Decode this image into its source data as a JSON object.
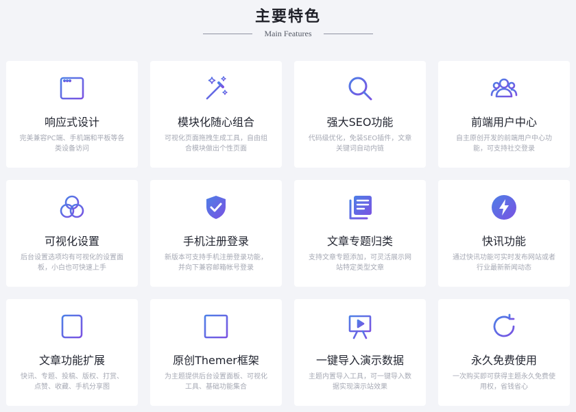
{
  "header": {
    "title": "主要特色",
    "subtitle": "Main Features"
  },
  "colors": {
    "icon_gradient_start": "#4d7fe6",
    "icon_gradient_end": "#7a52e2"
  },
  "features": [
    {
      "label": "响应式设计",
      "desc": "完美兼容PC端、手机端和平板等各类设备访问",
      "icon": "browser-window-icon"
    },
    {
      "label": "模块化随心组合",
      "desc": "可视化页面拖拽生成工具，自由组合模块做出个性页面",
      "icon": "magic-wand-icon"
    },
    {
      "label": "强大SEO功能",
      "desc": "代码级优化，免装SEO插件，文章关键词自动内链",
      "icon": "search-icon"
    },
    {
      "label": "前端用户中心",
      "desc": "自主原创开发的前端用户中心功能，可支持社交登录",
      "icon": "users-icon"
    },
    {
      "label": "可视化设置",
      "desc": "后台设置选项均有可视化的设置面板，小白也可快速上手",
      "icon": "venn-circles-icon"
    },
    {
      "label": "手机注册登录",
      "desc": "新版本可支持手机注册登录功能，并向下兼容邮箱帐号登录",
      "icon": "shield-check-icon"
    },
    {
      "label": "文章专题归类",
      "desc": "支持文章专题添加，可灵活展示网站特定类型文章",
      "icon": "stacked-documents-icon"
    },
    {
      "label": "快讯功能",
      "desc": "通过快讯功能可实时发布网站或者行业最新新闻动态",
      "icon": "lightning-bolt-icon"
    },
    {
      "label": "文章功能扩展",
      "desc": "快讯、专题、投稿、版权、打赏、点赞、收藏、手机分享图",
      "icon": "document-lines-icon"
    },
    {
      "label": "原创Themer框架",
      "desc": "为主题提供后台设置面板、可视化工具、基础功能集合",
      "icon": "layout-frame-icon"
    },
    {
      "label": "一键导入演示数据",
      "desc": "主题内置导入工具，可一键导入数据实现演示站效果",
      "icon": "presentation-board-icon"
    },
    {
      "label": "永久免费使用",
      "desc": "一次购买即可获得主题永久免费使用权，省钱省心",
      "icon": "refresh-icon"
    }
  ]
}
